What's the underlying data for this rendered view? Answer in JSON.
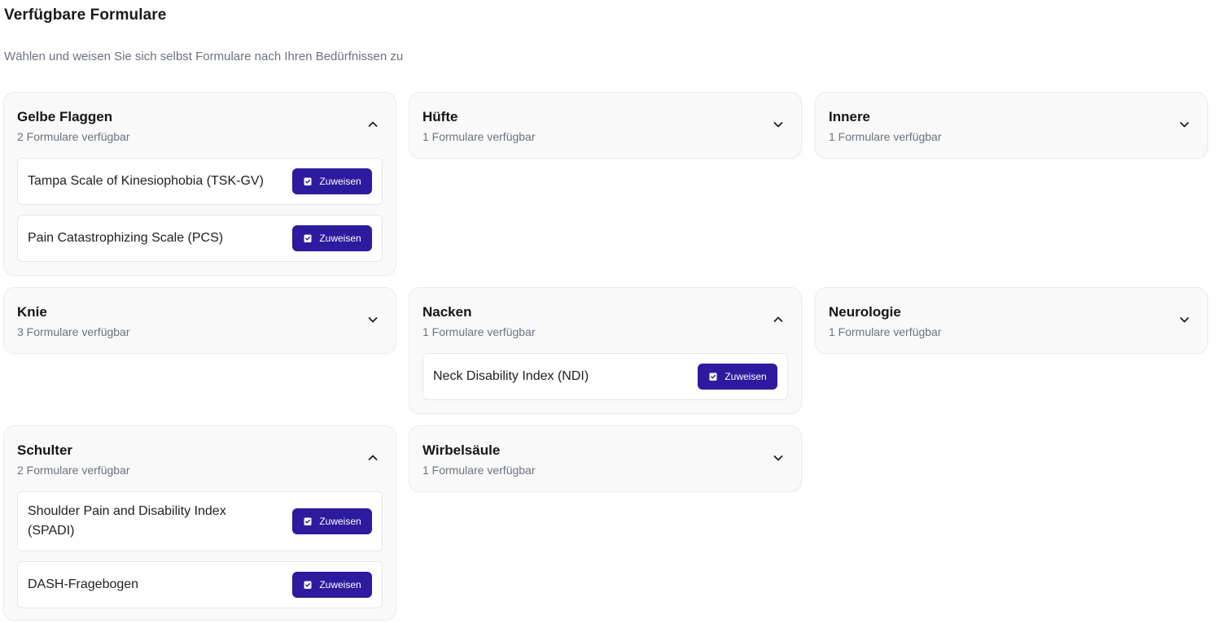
{
  "page": {
    "title": "Verfügbare Formulare",
    "subtitle": "Wählen und weisen Sie sich selbst Formulare nach Ihren Bedürfnissen zu"
  },
  "assign_label": "Zuweisen",
  "colors": {
    "accent": "#2d1a9e",
    "card_bg": "#f9f9f9",
    "muted_text": "#6b7280"
  },
  "categories": [
    {
      "title": "Gelbe Flaggen",
      "count": "2 Formulare verfügbar",
      "expanded": true,
      "forms": [
        "Tampa Scale of Kinesiophobia (TSK-GV)",
        "Pain Catastrophizing Scale (PCS)"
      ]
    },
    {
      "title": "Hüfte",
      "count": "1 Formulare verfügbar",
      "expanded": false,
      "forms": []
    },
    {
      "title": "Innere",
      "count": "1 Formulare verfügbar",
      "expanded": false,
      "forms": []
    },
    {
      "title": "Knie",
      "count": "3 Formulare verfügbar",
      "expanded": false,
      "forms": []
    },
    {
      "title": "Nacken",
      "count": "1 Formulare verfügbar",
      "expanded": true,
      "forms": [
        "Neck Disability Index (NDI)"
      ]
    },
    {
      "title": "Neurologie",
      "count": "1 Formulare verfügbar",
      "expanded": false,
      "forms": []
    },
    {
      "title": "Schulter",
      "count": "2 Formulare verfügbar",
      "expanded": true,
      "forms": [
        "Shoulder Pain and Disability Index (SPADI)",
        "DASH-Fragebogen"
      ]
    },
    {
      "title": "Wirbelsäule",
      "count": "1 Formulare verfügbar",
      "expanded": false,
      "forms": []
    }
  ]
}
